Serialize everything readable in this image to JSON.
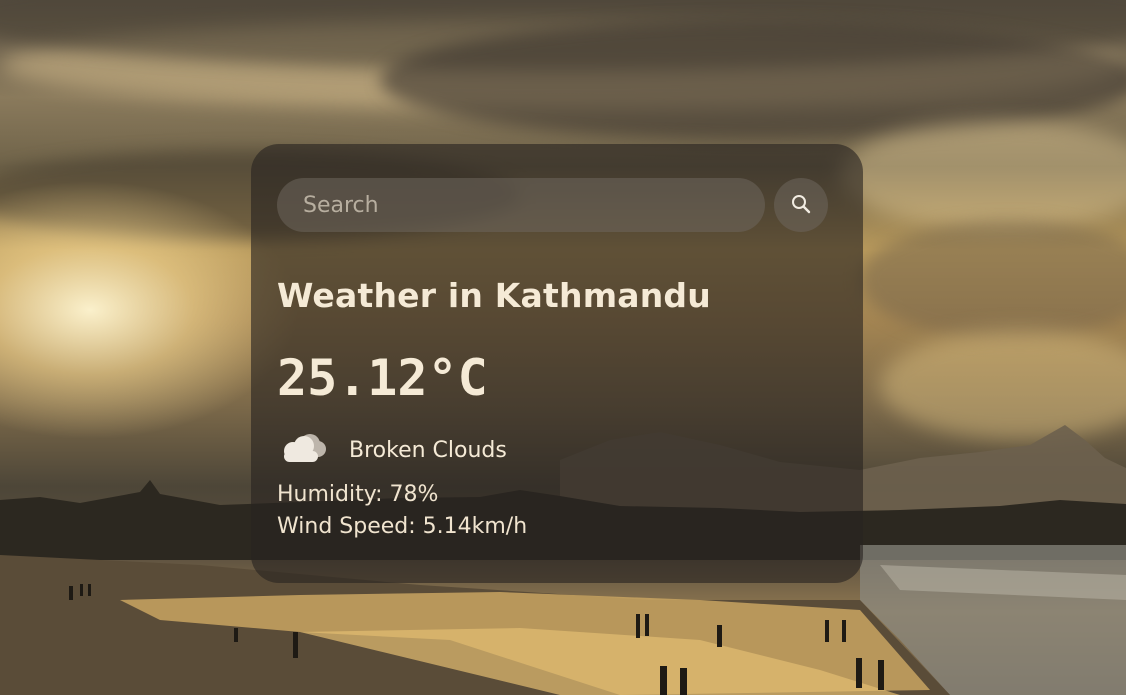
{
  "search": {
    "placeholder": "Search",
    "value": ""
  },
  "weather": {
    "heading": "Weather in Kathmandu",
    "temperature": "25.12°C",
    "description": "Broken Clouds",
    "humidity": "Humidity: 78%",
    "wind": "Wind Speed: 5.14km/h",
    "icon": "broken-clouds-icon"
  },
  "colors": {
    "card_bg": "#28242099",
    "text": "#f5ead6"
  }
}
